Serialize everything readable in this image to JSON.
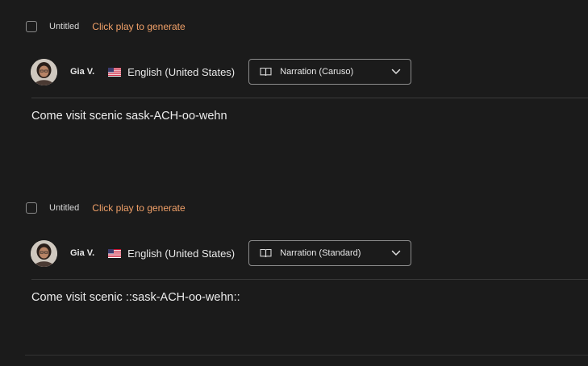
{
  "colors": {
    "background": "#1b1b1b",
    "accent_hint": "#f0a068",
    "border": "#8c8c8c",
    "divider": "#3a3a3a"
  },
  "blocks": [
    {
      "title": "Untitled",
      "generate_hint": "Click play to generate",
      "speaker": {
        "name": "Gia V.",
        "avatar": "avatar-photo"
      },
      "language": {
        "flag": "us-flag-icon",
        "label": "English (United States)"
      },
      "style": {
        "icon": "book-icon",
        "label": "Narration (Caruso)",
        "chevron": "chevron-down-icon"
      },
      "text": "Come visit scenic sask-ACH-oo-wehn"
    },
    {
      "title": "Untitled",
      "generate_hint": "Click play to generate",
      "speaker": {
        "name": "Gia V.",
        "avatar": "avatar-photo"
      },
      "language": {
        "flag": "us-flag-icon",
        "label": "English (United States)"
      },
      "style": {
        "icon": "book-icon",
        "label": "Narration (Standard)",
        "chevron": "chevron-down-icon"
      },
      "text": "Come visit scenic ::sask-ACH-oo-wehn::"
    }
  ]
}
